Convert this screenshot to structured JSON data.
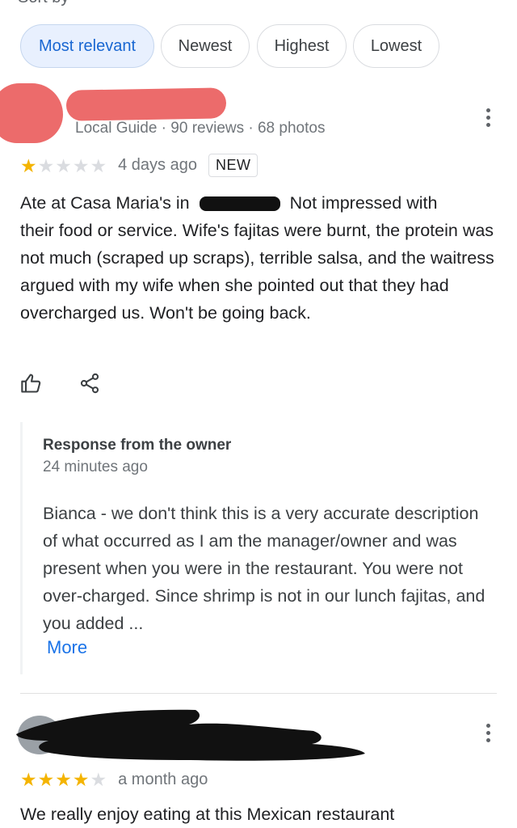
{
  "top_cut_text": "Sort by",
  "filters": {
    "chips": [
      {
        "label": "Most relevant",
        "active": true
      },
      {
        "label": "Newest",
        "active": false
      },
      {
        "label": "Highest",
        "active": false
      },
      {
        "label": "Lowest",
        "active": false
      }
    ]
  },
  "review1": {
    "meta": "Local Guide · 90 reviews · 68 photos",
    "rating": 1,
    "date": "4 days ago",
    "badge": "NEW",
    "text_prefix": "Ate at Casa Maria's in",
    "text_line1_rest": "Not impressed with",
    "text_rest": "their food or service. Wife's fajitas were burnt, the protein was not much (scraped up scraps), terrible salsa, and the waitress argued with my wife when she pointed out that they had overcharged us. Won't be going back.",
    "icons": [
      "thumbs-up-icon",
      "share-icon"
    ]
  },
  "owner_response": {
    "title": "Response from the owner",
    "time": "24 minutes ago",
    "text": "Bianca - we don't think this is a very accurate description of what occurred as I am the manager/owner and was present when you were in the restaurant. You were not over-charged. Since shrimp is not in our lunch fajitas, and you added ...",
    "more_label": "More"
  },
  "review2": {
    "rating": 4,
    "date": "a month ago",
    "text_partial": "We really enjoy eating at this Mexican restaurant"
  },
  "colors": {
    "accent": "#1a73e8",
    "star": "#f4b400",
    "chip_active_bg": "#e8f0fe",
    "redaction_red": "#ec6b6b"
  }
}
